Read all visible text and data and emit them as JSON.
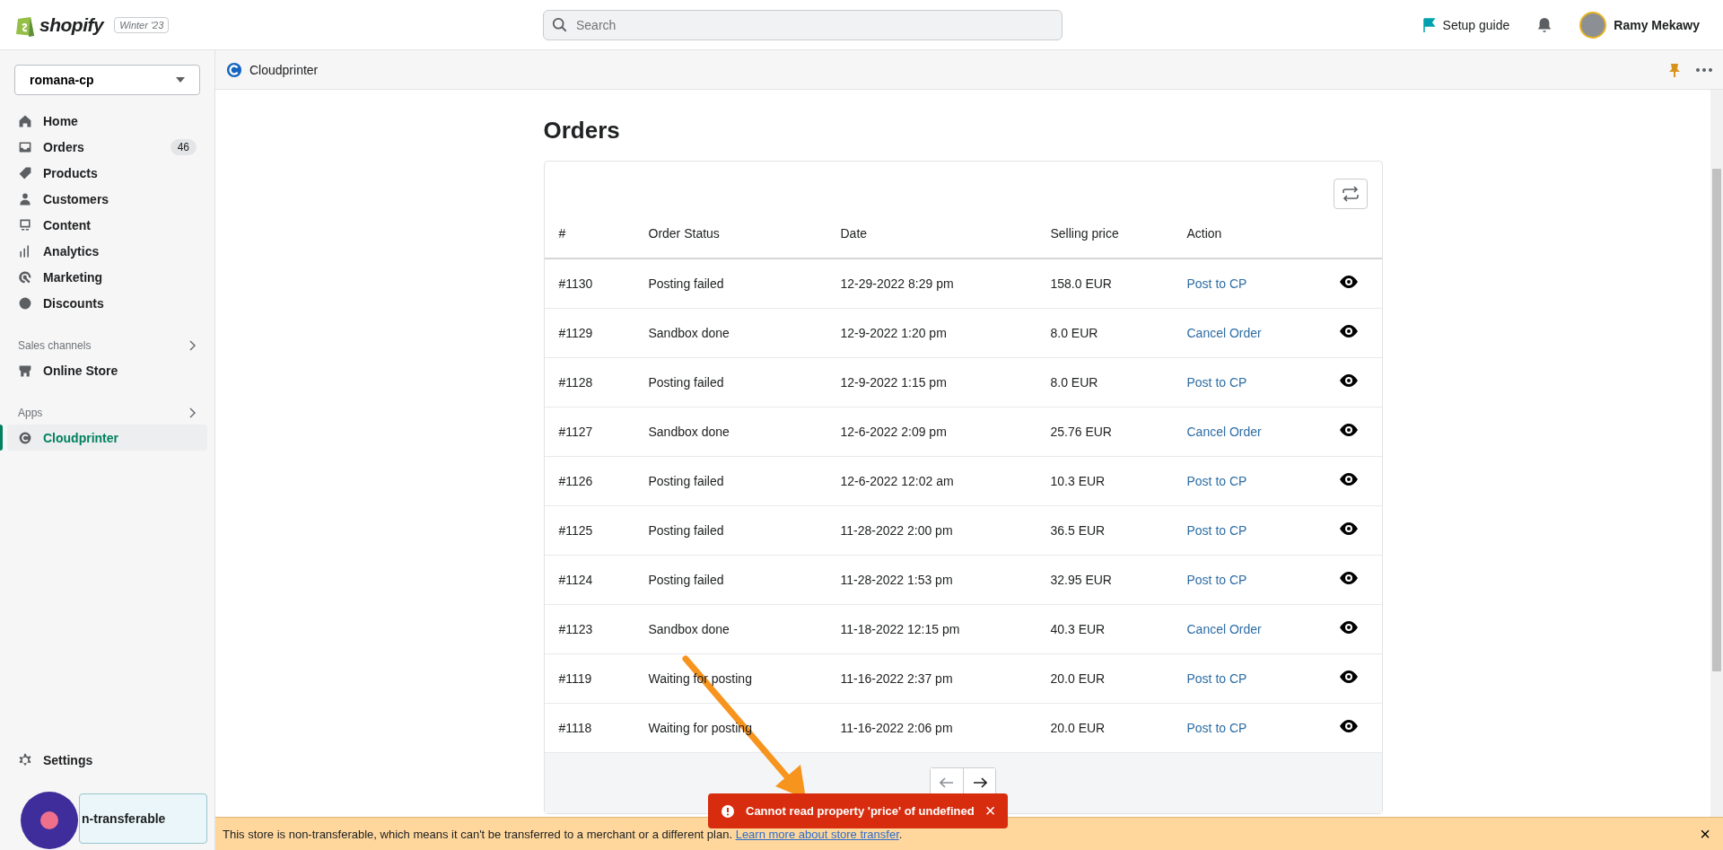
{
  "topbar": {
    "logo": "shopify",
    "badge": "Winter '23",
    "search": {
      "placeholder": "Search"
    },
    "setup_guide": "Setup guide",
    "user": "Ramy Mekawy"
  },
  "sidebar": {
    "store": "romana-cp",
    "items": [
      {
        "label": "Home",
        "selected": false
      },
      {
        "label": "Orders",
        "count": "46",
        "selected": false
      },
      {
        "label": "Products",
        "selected": false
      },
      {
        "label": "Customers",
        "selected": false
      },
      {
        "label": "Content",
        "selected": false
      },
      {
        "label": "Analytics",
        "selected": false
      },
      {
        "label": "Marketing",
        "selected": false
      },
      {
        "label": "Discounts",
        "selected": false
      }
    ],
    "sales_channels": {
      "title": "Sales channels",
      "items": [
        {
          "label": "Online Store",
          "selected": false
        }
      ]
    },
    "apps": {
      "title": "Apps",
      "items": [
        {
          "label": "Cloudprinter",
          "selected": true
        }
      ]
    },
    "settings": "Settings",
    "notice": "n-transferable"
  },
  "app_bar": {
    "title": "Cloudprinter"
  },
  "page": {
    "title": "Orders",
    "table": {
      "columns": [
        "#",
        "Order Status",
        "Date",
        "Selling price",
        "Action"
      ],
      "rows": [
        {
          "id": "#1130",
          "status": "Posting failed",
          "date": "12-29-2022 8:29 pm",
          "price": "158.0 EUR",
          "action": "Post to CP"
        },
        {
          "id": "#1129",
          "status": "Sandbox done",
          "date": "12-9-2022 1:20 pm",
          "price": "8.0 EUR",
          "action": "Cancel Order"
        },
        {
          "id": "#1128",
          "status": "Posting failed",
          "date": "12-9-2022 1:15 pm",
          "price": "8.0 EUR",
          "action": "Post to CP"
        },
        {
          "id": "#1127",
          "status": "Sandbox done",
          "date": "12-6-2022 2:09 pm",
          "price": "25.76 EUR",
          "action": "Cancel Order"
        },
        {
          "id": "#1126",
          "status": "Posting failed",
          "date": "12-6-2022 12:02 am",
          "price": "10.3 EUR",
          "action": "Post to CP"
        },
        {
          "id": "#1125",
          "status": "Posting failed",
          "date": "11-28-2022 2:00 pm",
          "price": "36.5 EUR",
          "action": "Post to CP"
        },
        {
          "id": "#1124",
          "status": "Posting failed",
          "date": "11-28-2022 1:53 pm",
          "price": "32.95 EUR",
          "action": "Post to CP"
        },
        {
          "id": "#1123",
          "status": "Sandbox done",
          "date": "11-18-2022 12:15 pm",
          "price": "40.3 EUR",
          "action": "Cancel Order"
        },
        {
          "id": "#1119",
          "status": "Waiting for posting",
          "date": "11-16-2022 2:37 pm",
          "price": "20.0 EUR",
          "action": "Post to CP"
        },
        {
          "id": "#1118",
          "status": "Waiting for posting",
          "date": "11-16-2022 2:06 pm",
          "price": "20.0 EUR",
          "action": "Post to CP"
        }
      ]
    }
  },
  "toast": {
    "message": "Cannot read property 'price' of undefined",
    "close": "×"
  },
  "banner": {
    "text": "This store is non-transferable, which means it can't be transferred to a merchant or a different plan.",
    "link": "Learn more about store transfer",
    "end": ".",
    "close": "×"
  }
}
